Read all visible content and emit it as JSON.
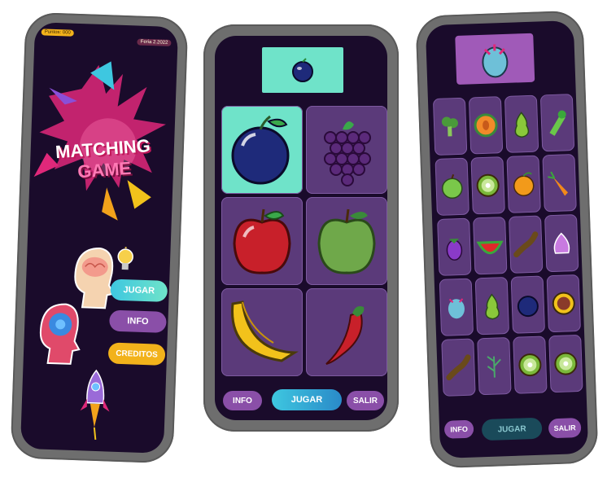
{
  "left_phone": {
    "points_label": "Puntos: 000",
    "date_label": "Feria 2.2022",
    "logo_line1": "MATCHING",
    "logo_line2": "GAME",
    "buttons": {
      "play": "JUGAR",
      "info": "INFO",
      "credits": "CREDITOS"
    }
  },
  "middle_phone": {
    "target_icon": "plum-icon",
    "cards": [
      "plum",
      "grapes",
      "red-apple",
      "green-apple",
      "banana",
      "chili-pepper"
    ],
    "buttons": {
      "info": "INFO",
      "play": "JUGAR",
      "exit": "SALIR"
    }
  },
  "right_phone": {
    "target_icon": "dragon-fruit-icon",
    "grid": [
      [
        "broccoli",
        "melon",
        "pear",
        "celery"
      ],
      [
        "green-apple",
        "kiwi",
        "orange",
        "carrot"
      ],
      [
        "eggplant",
        "watermelon",
        "tamarind",
        "garlic"
      ],
      [
        "dragon-fruit",
        "pear",
        "plum",
        "passion-fruit"
      ],
      [
        "tamarind",
        "rosemary",
        "kiwi",
        "kiwi"
      ]
    ],
    "buttons": {
      "info": "INFO",
      "play": "JUGAR",
      "exit": "SALIR"
    }
  },
  "colors": {
    "screen_bg": "#1a0b2b",
    "teal": "#4fd8c6",
    "purple": "#8a4fa8",
    "yellow": "#f2b21b",
    "tile": "#5b3a7a",
    "active_tile": "#6fe3c9"
  }
}
